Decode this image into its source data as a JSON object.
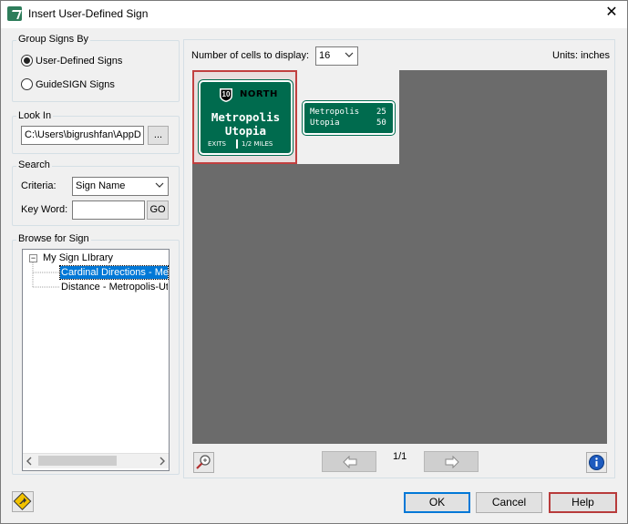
{
  "window": {
    "title": "Insert User-Defined Sign"
  },
  "group_by": {
    "label": "Group Signs By",
    "options": [
      {
        "label": "User-Defined Signs",
        "checked": true
      },
      {
        "label": "GuideSIGN Signs",
        "checked": false
      }
    ]
  },
  "look_in": {
    "label": "Look In",
    "path": "C:\\Users\\bigrushfan\\AppD",
    "browse_label": "..."
  },
  "search": {
    "label": "Search",
    "criteria_label": "Criteria:",
    "criteria_value": "Sign Name",
    "keyword_label": "Key Word:",
    "keyword_value": "",
    "go_label": "GO"
  },
  "browse": {
    "label": "Browse for Sign",
    "root": "My Sign LIbrary",
    "items": [
      {
        "label": "Cardinal Directions - Met",
        "selected": true
      },
      {
        "label": "Distance - Metropolis-Uto",
        "selected": false
      }
    ]
  },
  "preview": {
    "cells_label": "Number of cells to display:",
    "cells_value": "16",
    "units_label": "Units: inches",
    "page_label": "1/1"
  },
  "signs": [
    {
      "route_number": "10",
      "direction": "NORTH",
      "line1": "Metropolis",
      "line2": "Utopia",
      "exit_left": "EXITS",
      "exit_right": "1/2 MILES"
    },
    {
      "rows": [
        {
          "name": "Metropolis",
          "dist": "25"
        },
        {
          "name": "Utopia",
          "dist": "50"
        }
      ]
    }
  ],
  "buttons": {
    "ok": "OK",
    "cancel": "Cancel",
    "help": "Help"
  },
  "colors": {
    "sign_green": "#006b4e",
    "selection": "#0078d7",
    "cell_area": "#6b6b6b"
  },
  "icons": [
    "app-logo-icon",
    "close-icon",
    "zoom-icon",
    "arrow-left-icon",
    "arrow-right-icon",
    "info-icon",
    "insert-sign-icon"
  ]
}
